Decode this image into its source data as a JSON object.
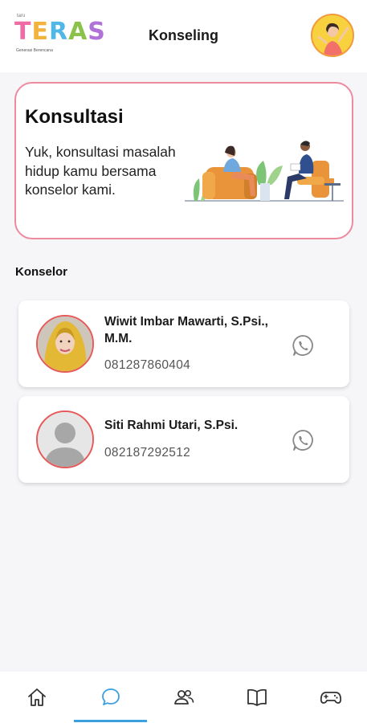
{
  "header": {
    "title": "Konseling",
    "logo": {
      "text": [
        "T",
        "E",
        "R",
        "A",
        "S"
      ],
      "subtitle": "Generasi Berencana",
      "superscript": "taru"
    }
  },
  "banner": {
    "title": "Konsultasi",
    "text": "Yuk, konsultasi masalah hidup kamu bersama konselor kami."
  },
  "counselors_section": {
    "title": "Konselor",
    "items": [
      {
        "name": "Wiwit Imbar Mawarti, S.Psi., M.M.",
        "phone": "081287860404",
        "avatar": "hijab-woman-photo",
        "action_icon": "whatsapp-icon"
      },
      {
        "name": "Siti Rahmi Utari, S.Psi.",
        "phone": "082187292512",
        "avatar": "default-user-placeholder",
        "action_icon": "whatsapp-icon"
      }
    ]
  },
  "bottom_nav": {
    "items": [
      {
        "icon": "home-icon",
        "active": false
      },
      {
        "icon": "chat-bubble-icon",
        "active": true
      },
      {
        "icon": "users-icon",
        "active": false
      },
      {
        "icon": "book-icon",
        "active": false
      },
      {
        "icon": "gamepad-icon",
        "active": false
      }
    ]
  },
  "colors": {
    "accent": "#3aa0e0",
    "banner_border": "#ec8aa0",
    "avatar_border": "#e65a5a",
    "header_avatar_bg": "#f7d23e"
  }
}
